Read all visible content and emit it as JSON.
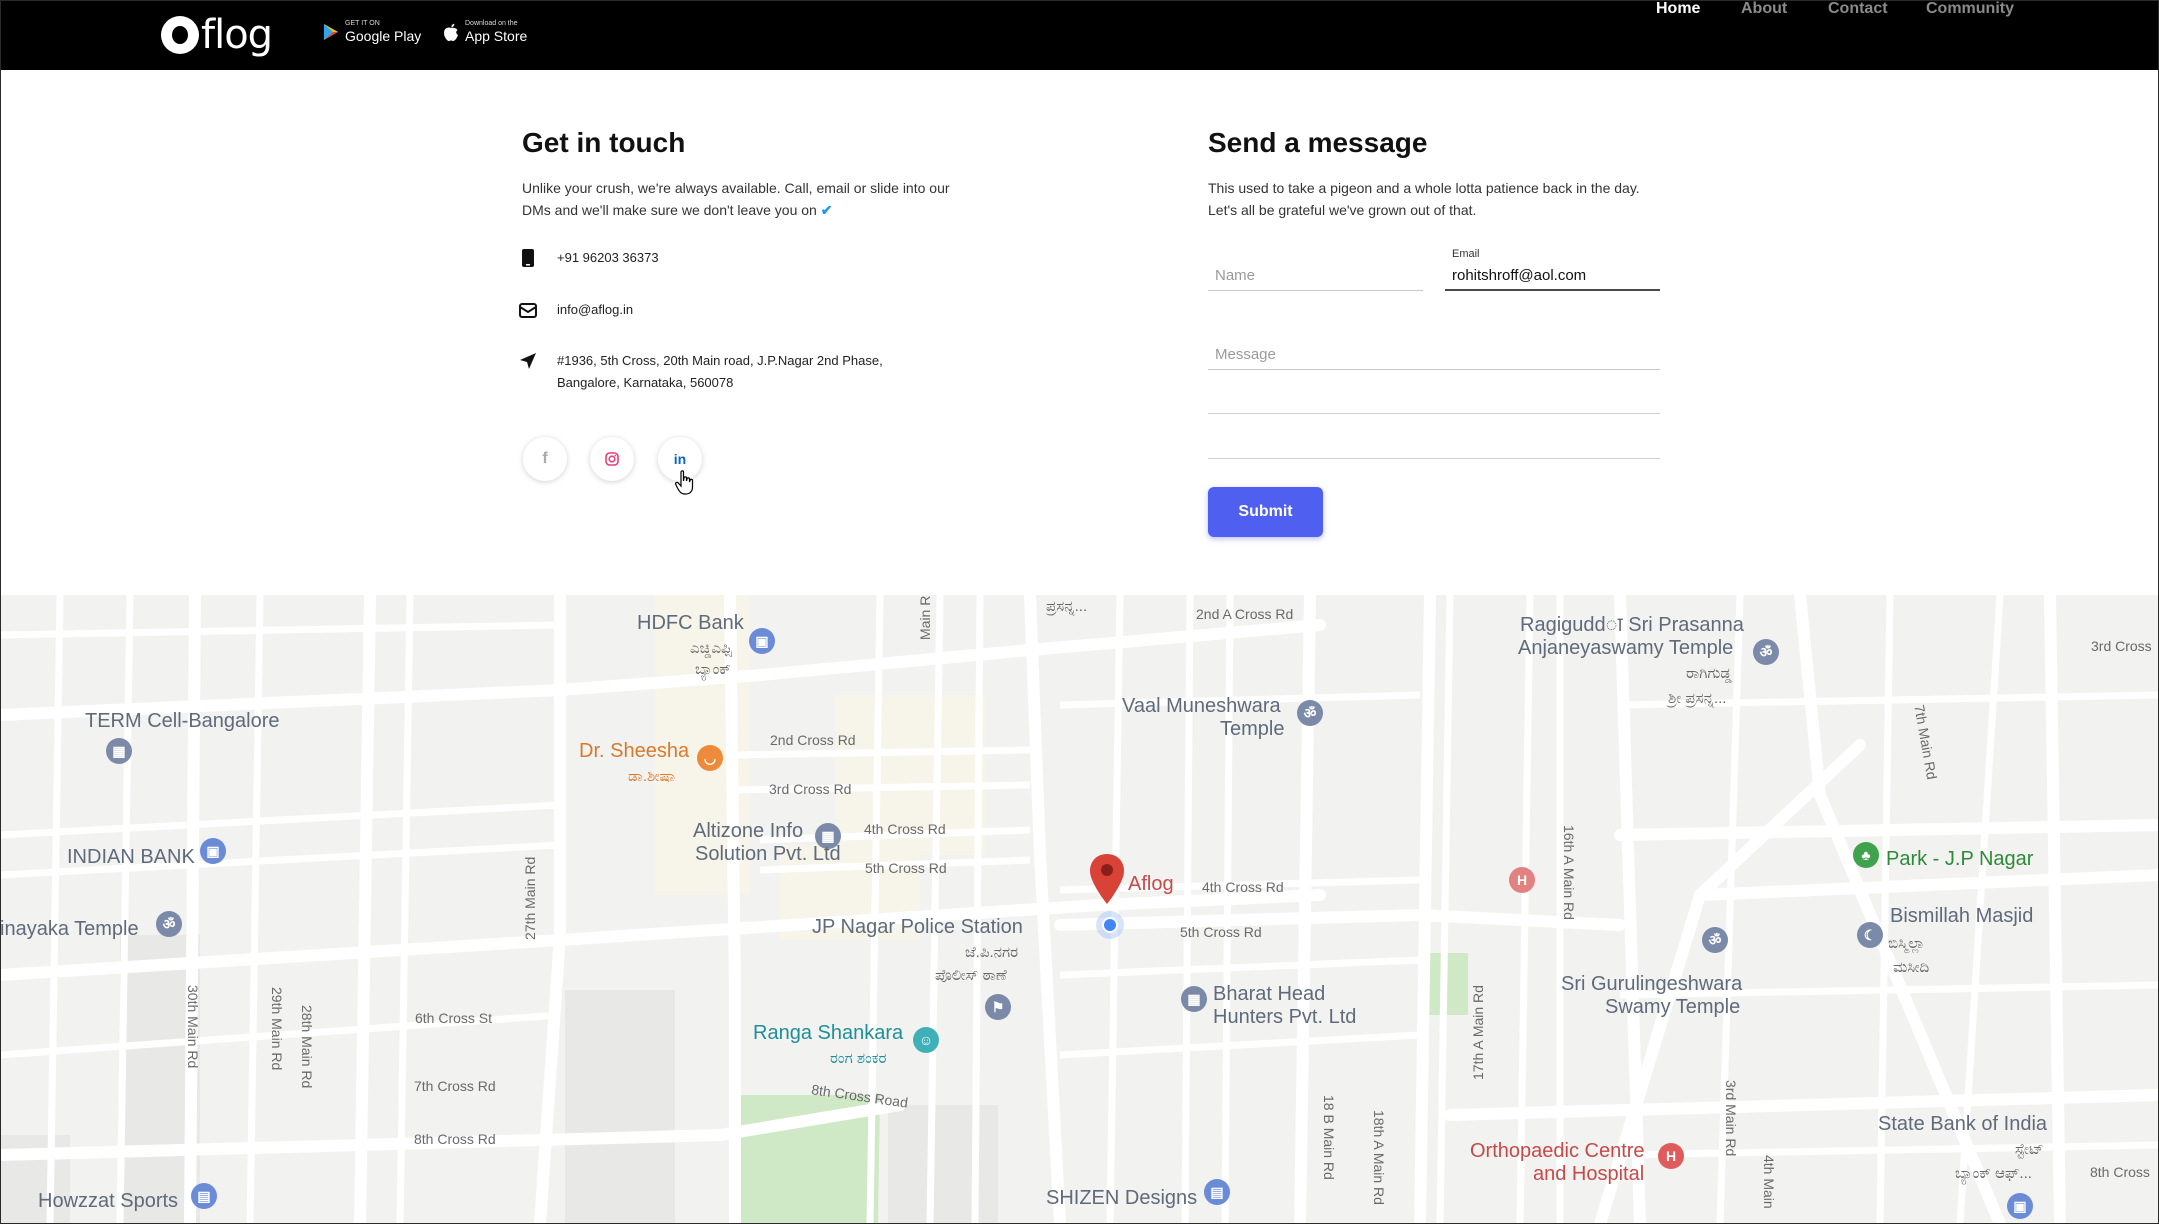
{
  "nav": {
    "logo_text": "flog",
    "google_play": {
      "small": "GET IT ON",
      "big": "Google Play"
    },
    "app_store": {
      "small": "Download on the",
      "big": "App Store"
    },
    "links": [
      "Home",
      "About",
      "Contact",
      "Community"
    ],
    "active": "Home"
  },
  "contact": {
    "title": "Get in touch",
    "intro_line1": "Unlike your crush, we're always available. Call, email or slide into our",
    "intro_line2": "DMs and we'll make sure we don't leave you on",
    "intro_check": "✔",
    "phone": "+91 96203 36373",
    "email": "info@aflog.in",
    "address_line1": "#1936, 5th Cross, 20th Main road, J.P.Nagar 2nd Phase,",
    "address_line2": "Bangalore, Karnataka, 560078",
    "social": {
      "facebook": "f",
      "linkedin": "in"
    }
  },
  "form": {
    "title": "Send a message",
    "intro_line1": "This used to take a pigeon and a whole lotta patience back in the day.",
    "intro_line2": "Let's all be grateful we've grown out of that.",
    "name_placeholder": "Name",
    "email_label": "Email",
    "email_value": "rohitshroff@aol.com",
    "message_placeholder": "Message",
    "submit_label": "Submit"
  },
  "map": {
    "marker_label": "Aflog",
    "places": {
      "hdfc": "HDFC Bank",
      "hdfc_kn1": "ಎಚ್ಡಿಎಫ್ಸಿ",
      "hdfc_kn2": "ಬ್ಯಾಂಕ್",
      "term": "TERM Cell-Bangalore",
      "sheesha": "Dr. Sheesha",
      "sheesha_kn": "ಡಾ.ಶೀಷಾ",
      "altizone1": "Altizone Info",
      "altizone2": "Solution Pvt. Ltd",
      "indian_bank": "INDIAN BANK",
      "vinayaka": "inayaka Temple",
      "police": "JP Nagar Police Station",
      "police_kn1": "ಜೆ.ಪಿ.ನಗರ",
      "police_kn2": "ಪೊಲೀಸ್ ಠಾಣೆ",
      "ranga": "Ranga Shankara",
      "ranga_kn": "ರಂಗ ಶಂಕರ",
      "howzzat": "Howzzat Sports",
      "shizen": "SHIZEN Designs",
      "vaal1": "Vaal Muneshwara",
      "vaal2": "Temple",
      "ragi1": "Ragiguddा Sri Prasanna",
      "ragi2": "Anjaneyaswamy Temple",
      "ragi_kn1": "ರಾಗಿಗುಡ್ಡ",
      "ragi_kn2": "ಶ್ರೀ ಪ್ರಸನ್ನ...",
      "prasanna_kn": "ಪ್ರಸನ್ನ...",
      "bharat1": "Bharat Head",
      "bharat2": "Hunters Pvt. Ltd",
      "park": "Park - J.P Nagar",
      "bismillah": "Bismillah Masjid",
      "bismillah_kn1": "ಬಿಸ್ಮಿಲ್ಲಾ",
      "bismillah_kn2": "ಮಸೀದಿ",
      "gurulinga1": "Sri Gurulingeshwara",
      "gurulinga2": "Swamy Temple",
      "ortho1": "Orthopaedic Centre",
      "ortho2": "and Hospital",
      "sbi": "State Bank of India",
      "sbi_kn1": "ಸ್ಟೇಟ್",
      "sbi_kn2": "ಬ್ಯಾಂಕ್ ಆಫ್..."
    },
    "roads": {
      "main_rd": "Main Rd",
      "a2nd": "2nd A Cross Rd",
      "c3rd": "3rd Cross",
      "m7th": "7th Main Rd",
      "c2nd": "2nd Cross Rd",
      "c3": "3rd Cross Rd",
      "c4": "4th Cross Rd",
      "c5": "5th Cross Rd",
      "c4b": "4th Cross Rd",
      "c5b": "5th Cross Rd",
      "m16a": "16th A Main Rd",
      "m27": "27th Main Rd",
      "m30": "30th Main Rd",
      "m29": "29th Main Rd",
      "m28": "28th Main Rd",
      "c6": "6th Cross St",
      "c7": "7th Cross Rd",
      "c8": "8th Cross Rd",
      "c8b": "8th Cross Road",
      "m17a": "17th A Main Rd",
      "m18b": "18 B Main Rd",
      "m18a": "18th A Main Rd",
      "m3rd": "3rd Main Rd",
      "m4th": "4th Main",
      "c8th": "8th Cross"
    }
  },
  "colors": {
    "accent": "#4f5ff0",
    "nav_bg": "#000000",
    "marker": "#d94236",
    "check": "#1e9be8"
  }
}
